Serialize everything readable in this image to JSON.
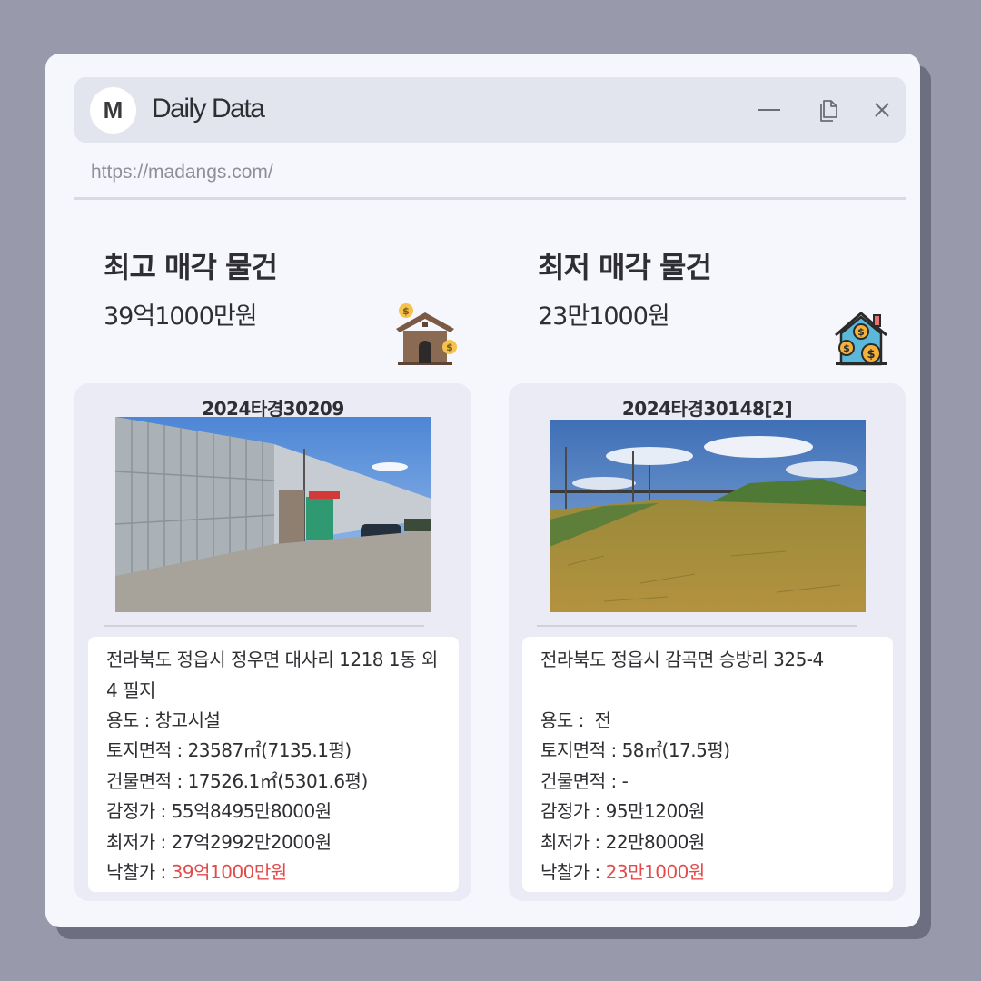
{
  "window": {
    "logo_letter": "M",
    "title": "Daily Data",
    "url": "https://madangs.com/"
  },
  "highest": {
    "heading": "최고 매각 물건",
    "price": "39억1000만원",
    "case_no": "2024타경30209",
    "address": "전라북도 정읍시 정우면 대사리 1218 1동 외 4 필지",
    "usage_label": "용도 : ",
    "usage": "창고시설",
    "land_area_label": "토지면적 : ",
    "land_area": "23587㎡(7135.1평)",
    "building_area_label": "건물면적 : ",
    "building_area": "17526.1㎡(5301.6평)",
    "appraisal_label": "감정가 : ",
    "appraisal": "55억8495만8000원",
    "minimum_label": "최저가 : ",
    "minimum": "27억2992만2000원",
    "winning_bid_label": "낙찰가 : ",
    "winning_bid": "39억1000만원"
  },
  "lowest": {
    "heading": "최저 매각 물건",
    "price": "23만1000원",
    "case_no": "2024타경30148[2]",
    "address": "전라북도 정읍시 감곡면 승방리 325-4",
    "usage_label": "용도 :  ",
    "usage": "전",
    "land_area_label": "토지면적 : ",
    "land_area": "58㎡(17.5평)",
    "building_area_label": "건물면적 : ",
    "building_area": "-",
    "appraisal_label": "감정가 : ",
    "appraisal": "95만1200원",
    "minimum_label": "최저가 : ",
    "minimum": "22만8000원",
    "winning_bid_label": "낙찰가 : ",
    "winning_bid": "23만1000원"
  },
  "icons": {
    "minimize": "minimize-icon",
    "copy": "copy-icon",
    "close": "close-icon",
    "highest": "house-money-icon",
    "lowest": "house-coins-icon"
  },
  "colors": {
    "background": "#989aac",
    "window": "#f6f7fc",
    "titlebar": "#e3e5ee",
    "card": "#eaebf4",
    "highlight_price": "#e24b4b"
  }
}
